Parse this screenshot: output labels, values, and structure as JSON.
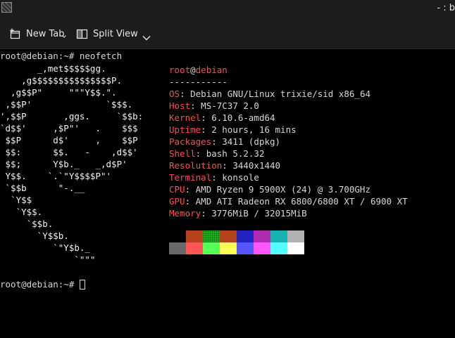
{
  "window": {
    "title": "- : b"
  },
  "toolbar": {
    "new_tab_label": "New Tab",
    "split_view_label": "Split View"
  },
  "terminal": {
    "command_line": "root@debian:~# neofetch",
    "prompt": "root@debian:~# ",
    "logo_lines": [
      "       _,met$$$$$gg.",
      "    ,g$$$$$$$$$$$$$$$P.",
      "  ,g$$P\"     \"\"\"Y$$.\".",
      " ,$$P'              `$$$.",
      "',$$P       ,ggs.     `$$b:",
      "`d$$'     ,$P\"'   .    $$$",
      " $$P      d$'     ,    $$P",
      " $$:      $$.   -    ,d$$'",
      " $$;      Y$b._   _,d$P'",
      " Y$$.    `.`\"Y$$$$P\"'",
      " `$$b      \"-.__",
      "  `Y$$",
      "   `Y$$.",
      "     `$$b.",
      "       `Y$$b.",
      "          `\"Y$b._",
      "              `\"\"\""
    ],
    "user_host": {
      "user": "root",
      "at": "@",
      "host": "debian"
    },
    "separator": "-----------",
    "info": [
      {
        "key": "OS",
        "value": "Debian GNU/Linux trixie/sid x86_64"
      },
      {
        "key": "Host",
        "value": "MS-7C37 2.0"
      },
      {
        "key": "Kernel",
        "value": "6.10.6-amd64"
      },
      {
        "key": "Uptime",
        "value": "2 hours, 16 mins"
      },
      {
        "key": "Packages",
        "value": "3411 (dpkg)"
      },
      {
        "key": "Shell",
        "value": "bash 5.2.32"
      },
      {
        "key": "Resolution",
        "value": "3440x1440"
      },
      {
        "key": "Terminal",
        "value": "konsole"
      },
      {
        "key": "CPU",
        "value": "AMD Ryzen 9 5900X (24) @ 3.700GHz"
      },
      {
        "key": "GPU",
        "value": "AMD ATI Radeon RX 6800/6800 XT / 6900 XT"
      },
      {
        "key": "Memory",
        "value": "3776MiB / 32015MiB"
      }
    ],
    "palette_row1": [
      "#000000",
      "#b5421c",
      "#22c22c",
      "#b5421c",
      "#2323c0",
      "#b22cb2",
      "#18b2b2",
      "#b2b2b2"
    ],
    "palette_row2": [
      "#686868",
      "#ff5555",
      "#55ff55",
      "#ffff55",
      "#5555ff",
      "#ff55ff",
      "#55ffff",
      "#ffffff"
    ],
    "colors": {
      "accent": "#ff4b4b",
      "text": "#d6d6d6",
      "background": "#000000"
    }
  }
}
